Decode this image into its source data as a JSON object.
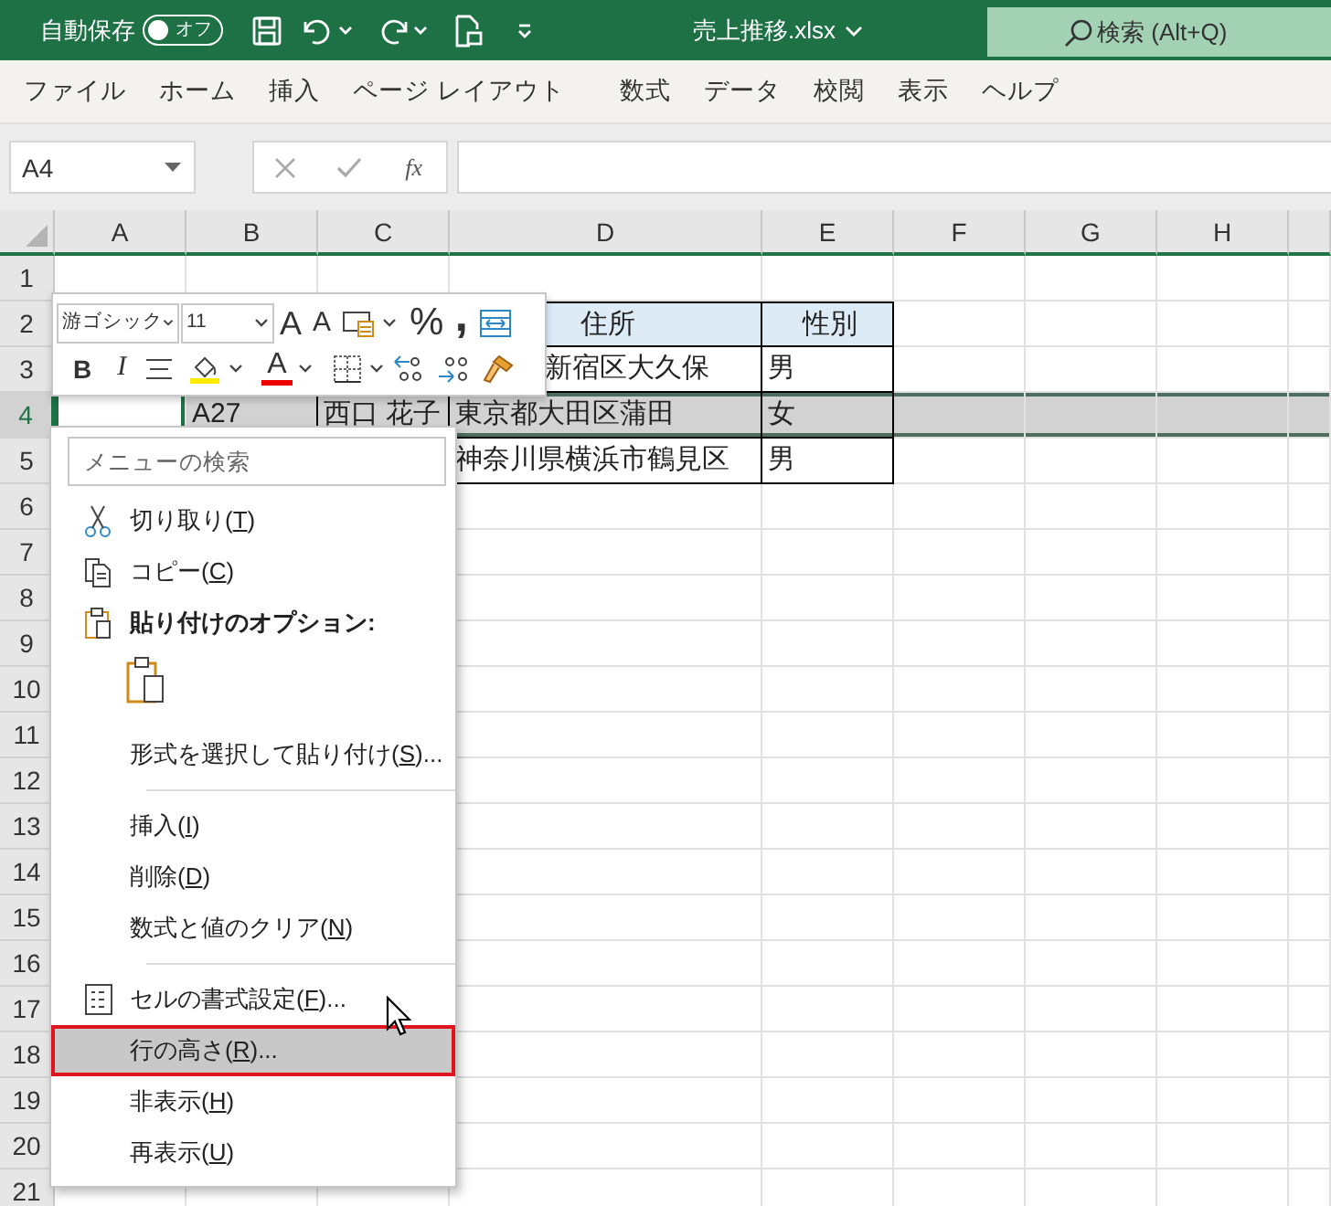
{
  "title_bar": {
    "autosave_label": "自動保存",
    "autosave_toggle": {
      "label": "オフ",
      "on": false
    },
    "file_name": "売上推移.xlsx",
    "search": {
      "placeholder": "検索 (Alt+Q)"
    }
  },
  "ribbon_tabs": [
    "ファイル",
    "ホーム",
    "挿入",
    "ページ レイアウト",
    "数式",
    "データ",
    "校閲",
    "表示",
    "ヘルプ"
  ],
  "formula_bar": {
    "name_box": "A4",
    "function_label": "fx"
  },
  "sheet": {
    "columns": [
      "A",
      "B",
      "C",
      "D",
      "E",
      "F",
      "G",
      "H"
    ],
    "rows": [
      {
        "header": "1",
        "selected": false
      },
      {
        "header": "2",
        "selected": false,
        "cells": [
          {},
          {},
          {},
          {
            "text": "住所",
            "kind": "header"
          },
          {
            "text": "性別",
            "kind": "header"
          }
        ]
      },
      {
        "header": "3",
        "selected": false,
        "cells": [
          {},
          {},
          {},
          {
            "text": "新宿区大久保",
            "kind": "data",
            "covered": true
          },
          {
            "text": "男",
            "kind": "data"
          }
        ]
      },
      {
        "header": "4",
        "selected": true,
        "cells": [
          {
            "active": true
          },
          {
            "text": "A27",
            "kind": "data"
          },
          {
            "text": "西口 花子",
            "kind": "data"
          },
          {
            "text": "東京都大田区蒲田",
            "kind": "data"
          },
          {
            "text": "女",
            "kind": "data"
          }
        ]
      },
      {
        "header": "5",
        "selected": false,
        "cells": [
          {},
          {},
          {},
          {
            "text": "神奈川県横浜市鶴見区",
            "kind": "data"
          },
          {
            "text": "男",
            "kind": "data"
          }
        ]
      },
      {
        "header": "6",
        "selected": false
      },
      {
        "header": "7",
        "selected": false
      },
      {
        "header": "8",
        "selected": false
      },
      {
        "header": "9",
        "selected": false
      },
      {
        "header": "10",
        "selected": false
      },
      {
        "header": "11",
        "selected": false
      },
      {
        "header": "12",
        "selected": false
      },
      {
        "header": "13",
        "selected": false
      },
      {
        "header": "14",
        "selected": false
      },
      {
        "header": "15",
        "selected": false
      },
      {
        "header": "16",
        "selected": false
      },
      {
        "header": "17",
        "selected": false
      },
      {
        "header": "18",
        "selected": false
      },
      {
        "header": "19",
        "selected": false
      },
      {
        "header": "20",
        "selected": false
      },
      {
        "header": "21",
        "selected": false
      }
    ]
  },
  "mini_toolbar": {
    "font_name": "游ゴシック",
    "font_size": "11",
    "grow_font": "A",
    "shrink_font": "A",
    "percent": "%",
    "comma_style": ",",
    "bold": "B",
    "italic": "I",
    "font_color": "A"
  },
  "context_menu": {
    "search": {
      "placeholder": "メニューの検索"
    },
    "items": [
      {
        "kind": "cut",
        "label": "切り取り(T)",
        "selected": false
      },
      {
        "kind": "copy",
        "label": "コピー(C)",
        "selected": false
      },
      {
        "kind": "heading",
        "label": "貼り付けのオプション:"
      },
      {
        "kind": "paste_option"
      },
      {
        "kind": "item",
        "label": "形式を選択して貼り付け(S)...",
        "selected": false
      },
      {
        "kind": "separator"
      },
      {
        "kind": "item",
        "label": "挿入(I)",
        "selected": false
      },
      {
        "kind": "item",
        "label": "削除(D)",
        "selected": false
      },
      {
        "kind": "item",
        "label": "数式と値のクリア(N)",
        "selected": false
      },
      {
        "kind": "separator"
      },
      {
        "kind": "format",
        "label": "セルの書式設定(F)...",
        "selected": false
      },
      {
        "kind": "item",
        "label": "行の高さ(R)...",
        "selected": true
      },
      {
        "kind": "item",
        "label": "非表示(H)",
        "selected": false
      },
      {
        "kind": "item",
        "label": "再表示(U)",
        "selected": false
      }
    ]
  }
}
